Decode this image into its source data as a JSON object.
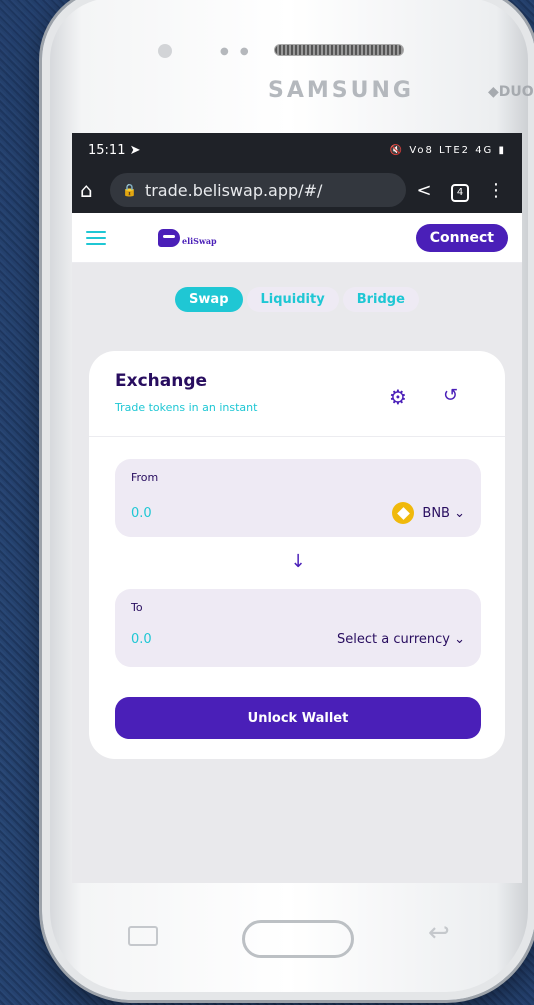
{
  "device": {
    "brand": "SAMSUNG",
    "model_tag": "DUOS"
  },
  "statusbar": {
    "time": "15:11",
    "icons": "Vo8 LTE2 4G"
  },
  "browser": {
    "url": "trade.beliswap.app/#/",
    "tab_count": "4"
  },
  "app": {
    "logo_text": "eliSwap",
    "connect_label": "Connect",
    "tabs": [
      {
        "label": "Swap",
        "active": true
      },
      {
        "label": "Liquidity",
        "active": false
      },
      {
        "label": "Bridge",
        "active": false
      }
    ],
    "exchange": {
      "title": "Exchange",
      "subtitle": "Trade tokens in an instant",
      "from": {
        "label": "From",
        "amount": "0.0",
        "currency": "BNB"
      },
      "to": {
        "label": "To",
        "amount": "0.0",
        "currency": "Select a currency"
      },
      "unlock_label": "Unlock Wallet"
    }
  },
  "colors": {
    "accent": "#1fc7d4",
    "primary": "#4a1fb8",
    "text": "#280d5f",
    "panel": "#eeeaf4"
  }
}
